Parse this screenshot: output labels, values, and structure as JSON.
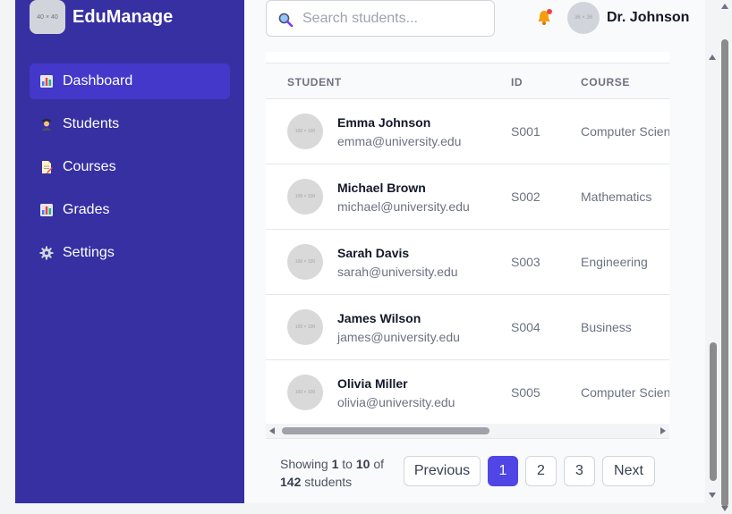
{
  "brand": {
    "logo_text": "40 × 40",
    "name": "EduManage"
  },
  "sidebar": {
    "items": [
      {
        "label": "Dashboard",
        "icon": "bar-chart-icon",
        "active": true
      },
      {
        "label": "Students",
        "icon": "student-icon",
        "active": false
      },
      {
        "label": "Courses",
        "icon": "document-icon",
        "active": false
      },
      {
        "label": "Grades",
        "icon": "bar-chart-icon",
        "active": false
      },
      {
        "label": "Settings",
        "icon": "gear-icon",
        "active": false
      }
    ]
  },
  "header": {
    "search_placeholder": "Search students...",
    "notification_dot": true,
    "avatar_text": "36 × 36",
    "user_name": "Dr. Johnson"
  },
  "table": {
    "columns": [
      "STUDENT",
      "ID",
      "COURSE"
    ],
    "rows": [
      {
        "avatar": "100 × 100",
        "name": "Emma Johnson",
        "email": "emma@university.edu",
        "id": "S001",
        "course": "Computer Science"
      },
      {
        "avatar": "100 × 100",
        "name": "Michael Brown",
        "email": "michael@university.edu",
        "id": "S002",
        "course": "Mathematics"
      },
      {
        "avatar": "100 × 100",
        "name": "Sarah Davis",
        "email": "sarah@university.edu",
        "id": "S003",
        "course": "Engineering"
      },
      {
        "avatar": "100 × 100",
        "name": "James Wilson",
        "email": "james@university.edu",
        "id": "S004",
        "course": "Business"
      },
      {
        "avatar": "100 × 100",
        "name": "Olivia Miller",
        "email": "olivia@university.edu",
        "id": "S005",
        "course": "Computer Science"
      }
    ]
  },
  "pagination": {
    "showing_prefix": "Showing",
    "from": "1",
    "to_word": "to",
    "to": "10",
    "of_word": "of",
    "total": "142",
    "suffix": "students",
    "previous_label": "Previous",
    "pages": [
      "1",
      "2",
      "3"
    ],
    "current_page": "1",
    "next_label": "Next"
  },
  "colors": {
    "sidebar_bg": "#3730a3",
    "sidebar_active": "#4338ca",
    "accent": "#4f46e5",
    "notification_dot": "#ef4444"
  }
}
